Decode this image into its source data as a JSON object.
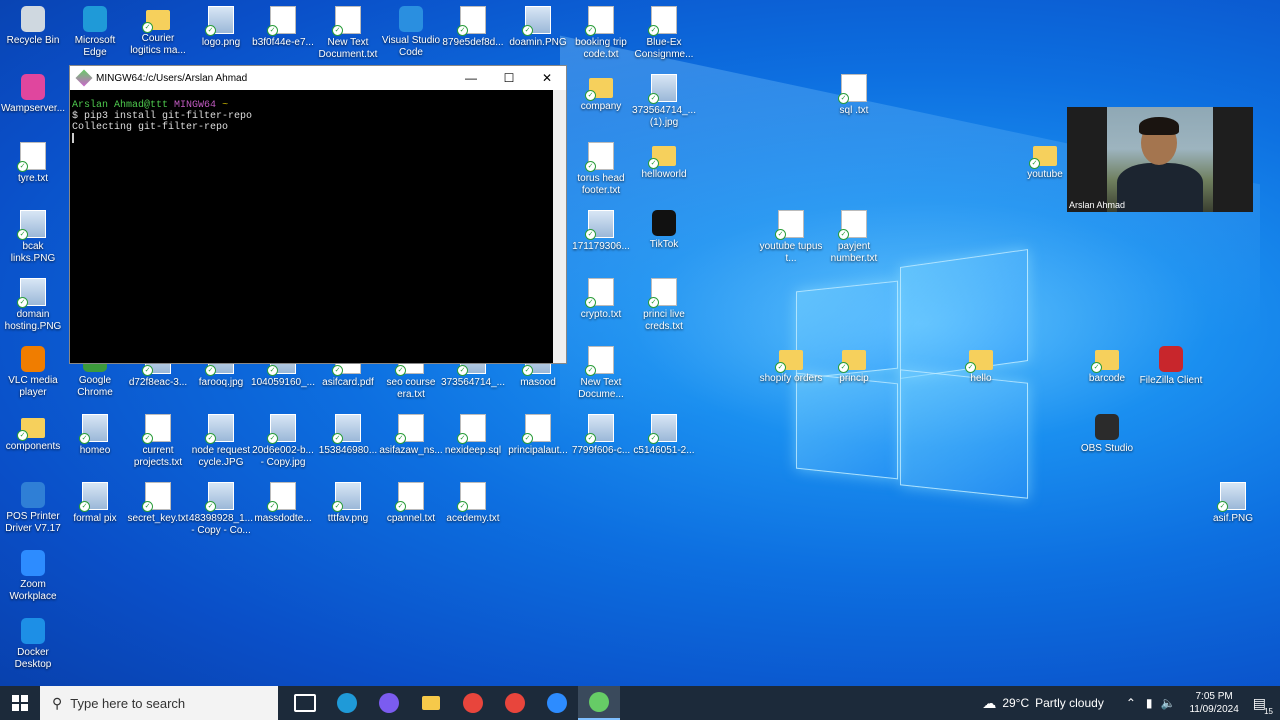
{
  "desktop_icons": [
    {
      "label": "Recycle Bin",
      "type": "app",
      "color": "#cfd8e0"
    },
    {
      "label": "Microsoft Edge",
      "type": "app",
      "color": "#1f9ad8"
    },
    {
      "label": "Courier logitics ma...",
      "type": "folder"
    },
    {
      "label": "logo.png",
      "type": "img"
    },
    {
      "label": "b3f0f44e-e7...",
      "type": "txt"
    },
    {
      "label": "New Text Document.txt",
      "type": "txt"
    },
    {
      "label": "Visual Studio Code",
      "type": "app",
      "color": "#2a8fe0"
    },
    {
      "label": "879e5def8d...",
      "type": "txt"
    },
    {
      "label": "doamin.PNG",
      "type": "img"
    },
    {
      "label": "booking trip code.txt",
      "type": "txt"
    },
    {
      "label": "Blue-Ex Consignme...",
      "type": "txt"
    },
    {
      "label": "Wampserver...",
      "type": "app",
      "color": "#e0469e"
    },
    {
      "label": "company",
      "type": "folder"
    },
    {
      "label": "373564714_... (1).jpg",
      "type": "img"
    },
    {
      "label": "sql .txt",
      "type": "txt"
    },
    {
      "label": "tyre.txt",
      "type": "txt"
    },
    {
      "label": "torus head footer.txt",
      "type": "txt"
    },
    {
      "label": "helloworld",
      "type": "folder"
    },
    {
      "label": "youtube",
      "type": "folder"
    },
    {
      "label": "bcak links.PNG",
      "type": "img"
    },
    {
      "label": "171179306...",
      "type": "img"
    },
    {
      "label": "TikTok",
      "type": "app",
      "color": "#111111"
    },
    {
      "label": "youtube tupus t...",
      "type": "txt"
    },
    {
      "label": "payjent number.txt",
      "type": "txt"
    },
    {
      "label": "domain hosting.PNG",
      "type": "img"
    },
    {
      "label": "crypto.txt",
      "type": "txt"
    },
    {
      "label": "princi live creds.txt",
      "type": "txt"
    },
    {
      "label": "VLC media player",
      "type": "app",
      "color": "#f07d00"
    },
    {
      "label": "Google Chrome",
      "type": "app",
      "color": "#3c9a3c"
    },
    {
      "label": "d72f8eac-3...",
      "type": "img"
    },
    {
      "label": "farooq.jpg",
      "type": "img"
    },
    {
      "label": "104059160_...",
      "type": "img"
    },
    {
      "label": "asifcard.pdf",
      "type": "txt"
    },
    {
      "label": "seo course era.txt",
      "type": "txt"
    },
    {
      "label": "373564714_...",
      "type": "img"
    },
    {
      "label": "masood",
      "type": "img"
    },
    {
      "label": "New Text Docume...",
      "type": "txt"
    },
    {
      "label": "shopify orders",
      "type": "folder"
    },
    {
      "label": "princip",
      "type": "folder"
    },
    {
      "label": "hello",
      "type": "folder"
    },
    {
      "label": "barcode",
      "type": "folder"
    },
    {
      "label": "FileZilla Client",
      "type": "app",
      "color": "#c8262c"
    },
    {
      "label": "components",
      "type": "folder"
    },
    {
      "label": "homeo",
      "type": "img"
    },
    {
      "label": "current projects.txt",
      "type": "txt"
    },
    {
      "label": "node request cycle.JPG",
      "type": "img"
    },
    {
      "label": "20d6e002-b... - Copy.jpg",
      "type": "img"
    },
    {
      "label": "153846980...",
      "type": "img"
    },
    {
      "label": "asifazaw_ns...",
      "type": "txt"
    },
    {
      "label": "nexideep.sql",
      "type": "txt"
    },
    {
      "label": "principalaut...",
      "type": "txt"
    },
    {
      "label": "7799f606-c...",
      "type": "img"
    },
    {
      "label": "c5146051-2...",
      "type": "img"
    },
    {
      "label": "OBS Studio",
      "type": "app",
      "color": "#2b2b2b"
    },
    {
      "label": "POS Printer Driver V7.17",
      "type": "app",
      "color": "#2f7fd6"
    },
    {
      "label": "formal pix",
      "type": "img"
    },
    {
      "label": "secret_key.txt",
      "type": "txt"
    },
    {
      "label": "48398928_1... - Copy - Co...",
      "type": "img"
    },
    {
      "label": "massdodte...",
      "type": "txt"
    },
    {
      "label": "tttfav.png",
      "type": "img"
    },
    {
      "label": "cpannel.txt",
      "type": "txt"
    },
    {
      "label": "acedemy.txt",
      "type": "txt"
    },
    {
      "label": "asif.PNG",
      "type": "img"
    },
    {
      "label": "Zoom Workplace",
      "type": "app",
      "color": "#2d8cff"
    },
    {
      "label": "Docker Desktop",
      "type": "app",
      "color": "#1d8fe6"
    }
  ],
  "terminal": {
    "title": "MINGW64:/c/Users/Arslan Ahmad",
    "prompt_user": "Arslan Ahmad@ttt",
    "prompt_env": "MINGW64",
    "prompt_path": "~",
    "command": "$ pip3 install git-filter-repo",
    "output": "Collecting git-filter-repo",
    "minimize": "—",
    "maximize": "☐",
    "close": "✕"
  },
  "webcam": {
    "name": "Arslan Ahmad"
  },
  "taskbar": {
    "search_placeholder": "Type here to search",
    "weather_temp": "29°C",
    "weather_desc": "Partly cloudy",
    "time": "7:05 PM",
    "date": "11/09/2024",
    "notif_count": "15",
    "apps": [
      {
        "name": "task-view",
        "color": "#ffffff"
      },
      {
        "name": "edge",
        "color": "#1f9ad8"
      },
      {
        "name": "copilot",
        "color": "#7b5cf0"
      },
      {
        "name": "file-explorer",
        "color": "#f6c94a"
      },
      {
        "name": "chrome",
        "color": "#e8453c"
      },
      {
        "name": "chrome-profile",
        "color": "#e8453c"
      },
      {
        "name": "zoom",
        "color": "#2d8cff"
      },
      {
        "name": "git-bash",
        "color": "#6c6"
      }
    ]
  }
}
